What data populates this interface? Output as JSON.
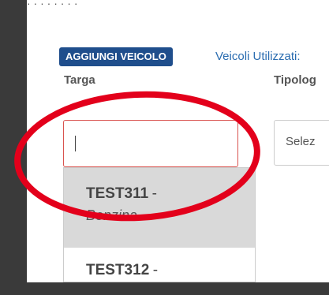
{
  "modal": {
    "top_text": "  · ·  ·  ·   ·   ·  ·   ·",
    "add_vehicle_button": "AGGIUNGI VEICOLO",
    "used_vehicles_link": "Veicoli Utilizzati:"
  },
  "form": {
    "targa_label": "Targa",
    "targa_value": "",
    "tipologia_label": "Tipolog",
    "tipologia_select": "Selez"
  },
  "dropdown": {
    "items": [
      {
        "plate": "TEST311",
        "dash": "-",
        "fuel": "Benzina",
        "highlighted": true
      },
      {
        "plate": "TEST312",
        "dash": "-"
      }
    ]
  },
  "colors": {
    "button_bg": "#1f4e8c",
    "link": "#2a6cb0",
    "annotation": "#e3001b",
    "error_border": "#d9534f"
  }
}
